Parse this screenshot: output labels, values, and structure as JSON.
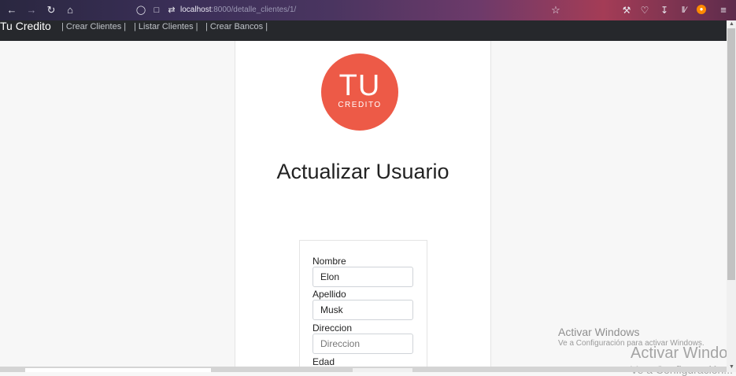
{
  "browser": {
    "url_host": "localhost",
    "url_path": ":8000/detalle_clientes/1/",
    "icons": [
      "back-icon",
      "forward-icon",
      "reload-icon",
      "home-icon",
      "shield-icon",
      "page-icon",
      "permissions-icon",
      "star-icon",
      "tools-icon",
      "pocket-icon",
      "download-icon",
      "library-icon",
      "extension-icon",
      "menu-icon"
    ]
  },
  "navbar": {
    "brand": "Tu Credito",
    "links": [
      "| Crear Clientes |",
      "| Listar Clientes |",
      "| Crear Bancos |"
    ]
  },
  "logo": {
    "line1": "TU",
    "line2": "CREDITO",
    "color": "#ed5a47"
  },
  "page": {
    "title": "Actualizar Usuario"
  },
  "form": {
    "fields": [
      {
        "label": "Nombre",
        "value": "Elon",
        "placeholder": ""
      },
      {
        "label": "Apellido",
        "value": "Musk",
        "placeholder": ""
      },
      {
        "label": "Direccion",
        "value": "",
        "placeholder": "Direccion"
      },
      {
        "label": "Edad",
        "value": "",
        "placeholder": ""
      }
    ]
  },
  "watermark": {
    "title": "Activar Windows",
    "subtitle": "Ve a Configuración para activar Windows.",
    "title_repeat": "Activar Window",
    "subtitle_repeat": "Ve a Configuración..."
  }
}
